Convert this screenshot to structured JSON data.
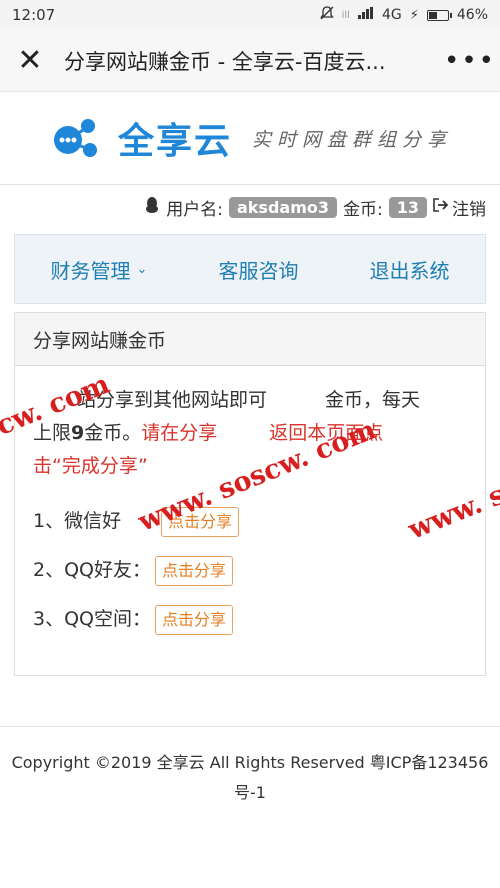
{
  "status": {
    "time": "12:07",
    "network": "4G",
    "battery": "46%",
    "battery_level": 0.46
  },
  "titlebar": {
    "title": "分享网站赚金币 - 全享云-百度云..."
  },
  "logo": {
    "name": "全享云",
    "slogan": "实时网盘群组分享"
  },
  "user": {
    "username_label": "用户名:",
    "username": "aksdamo3",
    "coins_label": "金币:",
    "coins": "13",
    "logout": "注销"
  },
  "nav": {
    "items": [
      {
        "label": "财务管理"
      },
      {
        "label": "客服咨询"
      },
      {
        "label": "退出系统"
      }
    ]
  },
  "panel": {
    "title": "分享网站赚金币",
    "desc_1": "站分享到其他网站即可",
    "desc_2": "金币，每天",
    "desc_3": "上限",
    "desc_4": "9",
    "desc_5": "金币。",
    "red_1": "请在分享",
    "red_2": "返回本页面点",
    "red_3": "击“完成分享”",
    "shares": [
      {
        "label": "1、微信好",
        "button": "点击分享"
      },
      {
        "label": "2、QQ好友：",
        "button": "点击分享"
      },
      {
        "label": "3、QQ空间：",
        "button": "点击分享"
      }
    ]
  },
  "watermarks": {
    "w1": "cw. com",
    "w2": "www. soscw. com",
    "w3": "www. s"
  },
  "footer": {
    "line1": "Copyright ©2019 全享云 All Rights Reserved 粤ICP备123456",
    "line2": "号-1"
  }
}
